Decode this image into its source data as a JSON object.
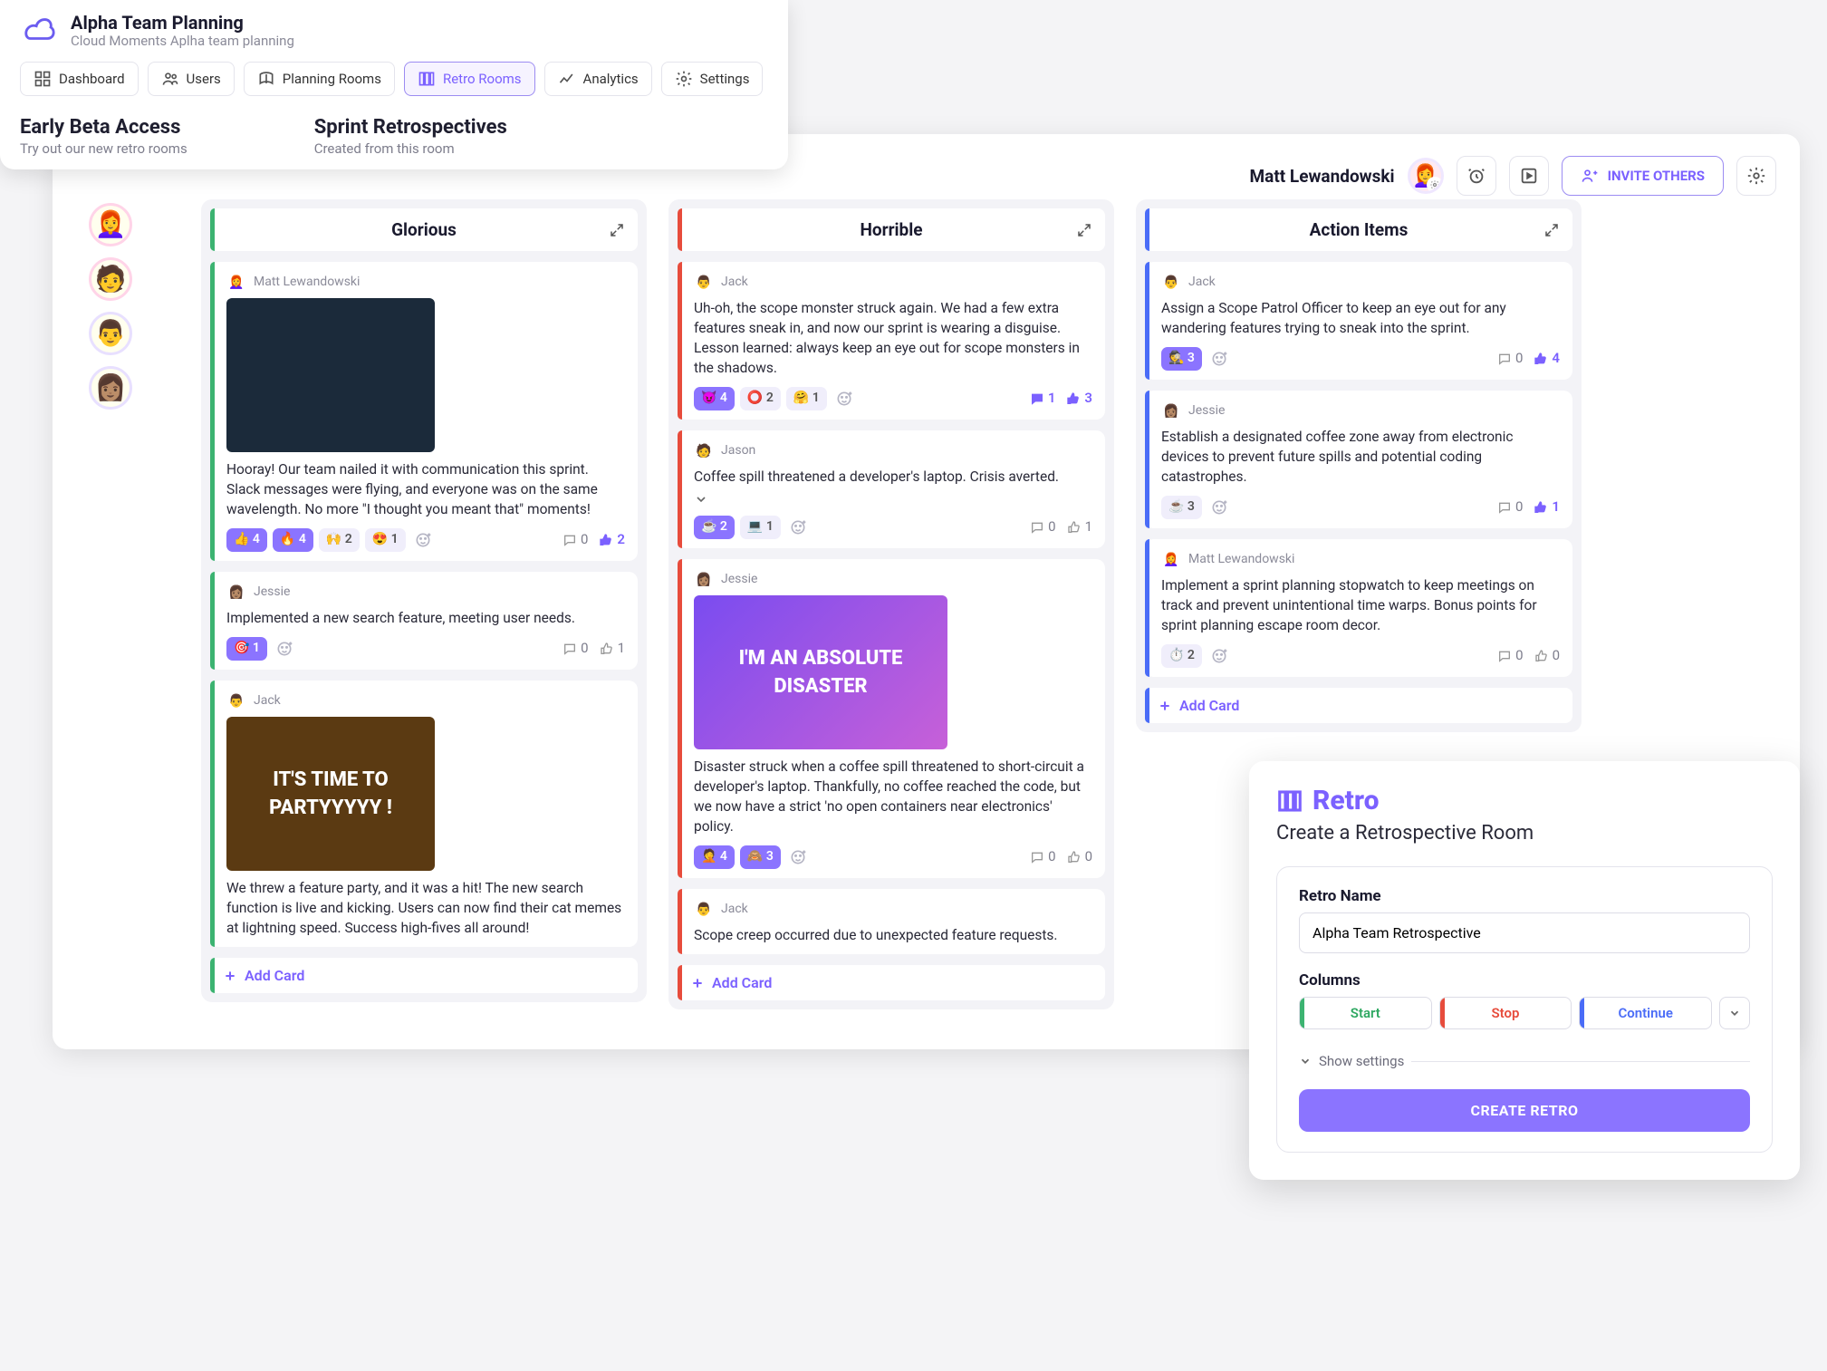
{
  "header": {
    "title": "Alpha Team Planning",
    "subtitle": "Cloud Moments Aplha team planning",
    "nav": [
      {
        "label": "Dashboard",
        "icon": "dashboard-icon"
      },
      {
        "label": "Users",
        "icon": "users-icon"
      },
      {
        "label": "Planning Rooms",
        "icon": "planning-icon"
      },
      {
        "label": "Retro Rooms",
        "icon": "retro-rooms-icon",
        "active": true
      },
      {
        "label": "Analytics",
        "icon": "analytics-icon"
      },
      {
        "label": "Settings",
        "icon": "settings-icon"
      }
    ],
    "footer_left_title": "Early Beta Access",
    "footer_left_sub": "Try out our new retro rooms",
    "footer_right_title": "Sprint Retrospectives",
    "footer_right_sub": "Created from this room"
  },
  "app": {
    "user_name": "Matt Lewandowski",
    "invite_label": "INVITE OTHERS"
  },
  "columns": [
    {
      "title": "Glorious",
      "accent": "acc-green",
      "cards": [
        {
          "author": "Matt Lewandowski",
          "avatar": "👩‍🦰",
          "image": true,
          "image_text": "",
          "image_bg": "#1b2a3a",
          "text": "Hooray! Our team nailed it with communication this sprint. Slack messages were flying, and everyone was on the same wavelength. No more \"I thought you meant that\" moments!",
          "reactions": [
            {
              "e": "👍",
              "n": "4",
              "hi": true
            },
            {
              "e": "🔥",
              "n": "4",
              "hi": true
            },
            {
              "e": "🙌",
              "n": "2",
              "hi": false
            },
            {
              "e": "😍",
              "n": "1",
              "hi": false
            }
          ],
          "comments": "0",
          "likes": "2",
          "likes_hi": true
        },
        {
          "author": "Jessie",
          "avatar": "👩🏽",
          "text": "Implemented a new search feature, meeting user needs.",
          "reactions": [
            {
              "e": "🎯",
              "n": "1",
              "hi": true
            }
          ],
          "comments": "0",
          "likes": "1",
          "likes_hi": false
        },
        {
          "author": "Jack",
          "avatar": "👨",
          "image": true,
          "image_text": "IT'S TIME TO PARTYYYYY !",
          "image_bg": "#5b3a12",
          "text": "We threw a feature party, and it was a hit! The new search function is live and kicking. Users can now find their cat memes at lightning speed. Success high-fives all around!",
          "reactions": [],
          "comments": "",
          "likes": ""
        }
      ],
      "add": "Add Card"
    },
    {
      "title": "Horrible",
      "accent": "acc-red",
      "cards": [
        {
          "author": "Jack",
          "avatar": "👨",
          "text": "Uh-oh, the scope monster struck again. We had a few extra features sneak in, and now our sprint is wearing a disguise. Lesson learned: always keep an eye out for scope monsters in the shadows.",
          "reactions": [
            {
              "e": "😈",
              "n": "4",
              "hi": true
            },
            {
              "e": "⭕",
              "n": "2",
              "hi": false
            },
            {
              "e": "🤗",
              "n": "1",
              "hi": false
            }
          ],
          "comments": "1",
          "comments_hi": true,
          "likes": "3",
          "likes_hi": true
        },
        {
          "author": "Jason",
          "avatar": "🧑",
          "text": "Coffee spill threatened a developer's laptop. Crisis averted.",
          "chevron": true,
          "reactions": [
            {
              "e": "☕",
              "n": "2",
              "hi": true
            },
            {
              "e": "💻",
              "n": "1",
              "hi": false
            }
          ],
          "comments": "0",
          "likes": "1",
          "likes_hi": false
        },
        {
          "author": "Jessie",
          "avatar": "👩🏽",
          "image": true,
          "image_text": "I'M AN ABSOLUTE DISASTER",
          "image_bg": "linear-gradient(135deg,#7a4cf0,#c760d8)",
          "text": "Disaster struck when a coffee spill threatened to short-circuit a developer's laptop. Thankfully, no coffee reached the code, but we now have a strict 'no open containers near electronics' policy.",
          "reactions": [
            {
              "e": "🤦",
              "n": "4",
              "hi": true
            },
            {
              "e": "🙈",
              "n": "3",
              "hi": true
            }
          ],
          "comments": "0",
          "likes": "0",
          "likes_hi": false
        },
        {
          "author": "Jack",
          "avatar": "👨",
          "text": "Scope creep occurred due to unexpected feature requests.",
          "reactions": [],
          "comments": "",
          "likes": ""
        }
      ],
      "add": "Add Card"
    },
    {
      "title": "Action Items",
      "accent": "acc-blue",
      "cards": [
        {
          "author": "Jack",
          "avatar": "👨",
          "text": "Assign a Scope Patrol Officer to keep an eye out for any wandering features trying to sneak into the sprint.",
          "reactions": [
            {
              "e": "🕵️",
              "n": "3",
              "hi": true
            }
          ],
          "comments": "0",
          "likes": "4",
          "likes_hi": true
        },
        {
          "author": "Jessie",
          "avatar": "👩🏽",
          "text": "Establish a designated coffee zone away from electronic devices to prevent future spills and potential coding catastrophes.",
          "reactions": [
            {
              "e": "☕",
              "n": "3",
              "hi": false
            }
          ],
          "comments": "0",
          "likes": "1",
          "likes_hi": true
        },
        {
          "author": "Matt Lewandowski",
          "avatar": "👩‍🦰",
          "text": "Implement a sprint planning stopwatch to keep meetings on track and prevent unintentional time warps. Bonus points for sprint planning escape room decor.",
          "reactions": [
            {
              "e": "⏱️",
              "n": "2",
              "hi": false
            }
          ],
          "comments": "0",
          "likes": "0",
          "likes_hi": false
        }
      ],
      "add": "Add Card"
    }
  ],
  "retro_modal": {
    "title": "Retro",
    "subtitle": "Create a Retrospective Room",
    "name_label": "Retro Name",
    "name_value": "Alpha Team Retrospective",
    "columns_label": "Columns",
    "pills": [
      {
        "label": "Start",
        "color": "green"
      },
      {
        "label": "Stop",
        "color": "red"
      },
      {
        "label": "Continue",
        "color": "blue"
      }
    ],
    "show_settings": "Show settings",
    "create": "CREATE RETRO"
  }
}
